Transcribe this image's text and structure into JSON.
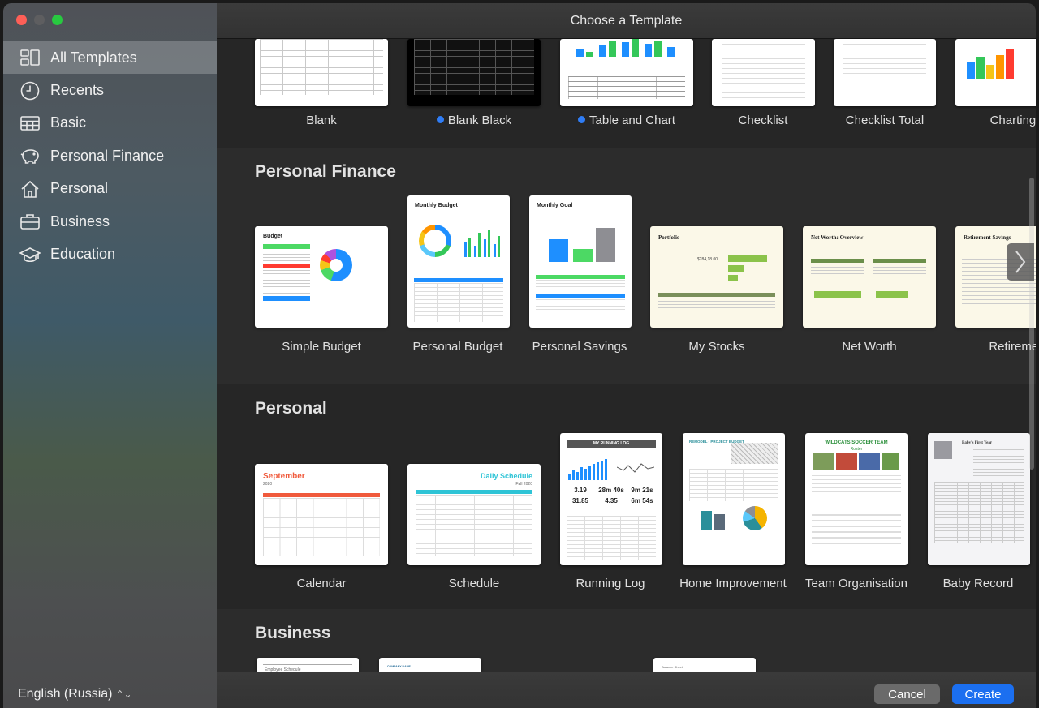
{
  "window": {
    "title": "Choose a Template"
  },
  "sidebar": {
    "items": [
      {
        "label": "All Templates",
        "icon": "all-templates-icon",
        "active": true
      },
      {
        "label": "Recents",
        "icon": "clock-icon"
      },
      {
        "label": "Basic",
        "icon": "table-icon"
      },
      {
        "label": "Personal Finance",
        "icon": "piggy-bank-icon"
      },
      {
        "label": "Personal",
        "icon": "house-icon"
      },
      {
        "label": "Business",
        "icon": "briefcase-icon"
      },
      {
        "label": "Education",
        "icon": "graduation-cap-icon"
      }
    ],
    "language": "English (Russia)"
  },
  "basic": {
    "templates": [
      {
        "label": "Blank",
        "new": false
      },
      {
        "label": "Blank Black",
        "new": true
      },
      {
        "label": "Table and Chart",
        "new": true
      },
      {
        "label": "Checklist",
        "new": false
      },
      {
        "label": "Checklist Total",
        "new": false
      },
      {
        "label": "Charting B",
        "new": false
      }
    ]
  },
  "personal_finance": {
    "title": "Personal Finance",
    "templates": [
      {
        "label": "Simple Budget",
        "thumb_title": "Budget"
      },
      {
        "label": "Personal Budget",
        "thumb_title": "Monthly Budget"
      },
      {
        "label": "Personal Savings",
        "thumb_title": "Monthly Goal"
      },
      {
        "label": "My Stocks",
        "thumb_title": "Portfolio",
        "thumb_value": "$284,18.00"
      },
      {
        "label": "Net Worth",
        "thumb_title": "Net Worth: Overview"
      },
      {
        "label": "Retirement",
        "thumb_title": "Retirement Savings"
      }
    ]
  },
  "personal": {
    "title": "Personal",
    "templates": [
      {
        "label": "Calendar",
        "thumb_title": "September",
        "thumb_sub": "2020"
      },
      {
        "label": "Schedule",
        "thumb_title": "Daily Schedule",
        "thumb_sub": "Fall 2020"
      },
      {
        "label": "Running Log",
        "thumb_title": "MY RUNNING LOG",
        "stats": [
          "3.19",
          "28m 40s",
          "9m 21s",
          "31.85",
          "4.35",
          "6m 54s"
        ]
      },
      {
        "label": "Home Improvement",
        "thumb_title": "REMODEL - PROJECT BUDGET"
      },
      {
        "label": "Team Organisation",
        "thumb_title": "WILDCATS SOCCER TEAM",
        "thumb_sub": "Roster"
      },
      {
        "label": "Baby Record",
        "thumb_title": "Baby's First Year"
      }
    ]
  },
  "business": {
    "title": "Business",
    "thumbs": [
      "Employee Schedule",
      "COMPANY NAME",
      "Balance Sheet"
    ]
  },
  "footer": {
    "cancel_label": "Cancel",
    "create_label": "Create"
  },
  "colors": {
    "accent": "#1b6ff0",
    "new_dot": "#2f7df6"
  }
}
